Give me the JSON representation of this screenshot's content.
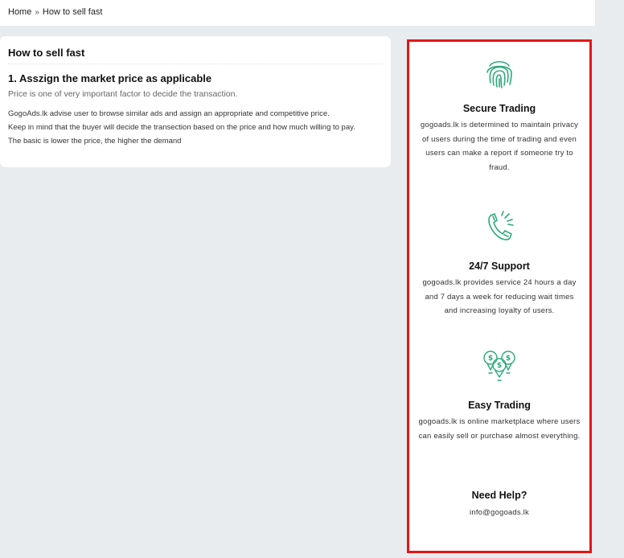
{
  "breadcrumb": {
    "home": "Home",
    "separator": "»",
    "current": "How to sell fast"
  },
  "article": {
    "title": "How to sell fast",
    "section_title": "1. Asszign the market price as applicable",
    "lead": "Price is one of very important factor to decide the transaction.",
    "lines": [
      "GogoAds.lk advise user to browse similar ads and assign an appropriate and competitive price.",
      "Keep in mind that the buyer will decide the transection based on the price and how much willing to pay.",
      "The basic is lower the price, the higher the demand"
    ]
  },
  "sidebar": {
    "features": [
      {
        "icon": "fingerprint-icon",
        "title": "Secure Trading",
        "text": "gogoads.lk is determined to maintain privacy of users during the time of trading and even users can make a report if someone try to fraud."
      },
      {
        "icon": "phone-support-icon",
        "title": "24/7 Support",
        "text": "gogoads.lk provides service 24 hours a day and 7 days a week for reducing wait times and increasing loyalty of users."
      },
      {
        "icon": "money-bulbs-icon",
        "title": "Easy Trading",
        "text": "gogoads.lk is online marketplace where users can easily sell or purchase almost everything."
      }
    ],
    "help": {
      "title": "Need Help?",
      "email": "info@gogoads.lk"
    }
  },
  "colors": {
    "accent_green": "#2eaa7a",
    "highlight_border": "#e41515",
    "page_bg": "#e8ecee"
  }
}
